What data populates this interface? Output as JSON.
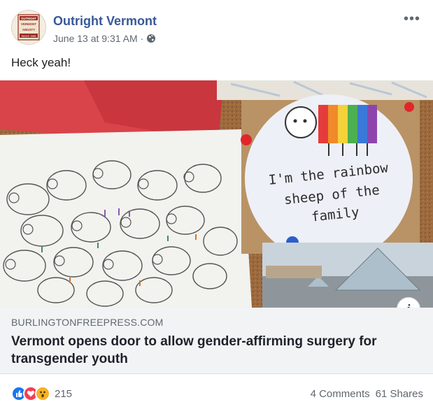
{
  "post": {
    "page_name": "Outright Vermont",
    "timestamp": "June 13 at 9:31 AM",
    "separator": "·",
    "privacy_icon": "globe-icon",
    "more_icon": "more-options-icon",
    "message": "Heck yeah!"
  },
  "avatar": {
    "lines": [
      "OUTRIGHT",
      "VERMONT",
      "ANGSTY",
      "SINCE 1989"
    ]
  },
  "link": {
    "image_sign_text": [
      "I'm the rainbow",
      "sheep of the",
      "family"
    ],
    "domain": "BURLINGTONFREEPRESS.COM",
    "headline": "Vermont opens door to allow gender-affirming surgery for transgender youth",
    "info_label": "i"
  },
  "footer": {
    "reaction_icons": [
      "like-icon",
      "love-icon",
      "wow-icon"
    ],
    "reaction_count": "215",
    "comments": "4 Comments",
    "shares": "61 Shares"
  },
  "colors": {
    "brand_link": "#385898",
    "like_blue": "#1877f2",
    "love_red": "#f33e58",
    "wow_yellow": "#f7b125",
    "caption_bg": "#f2f3f5"
  }
}
